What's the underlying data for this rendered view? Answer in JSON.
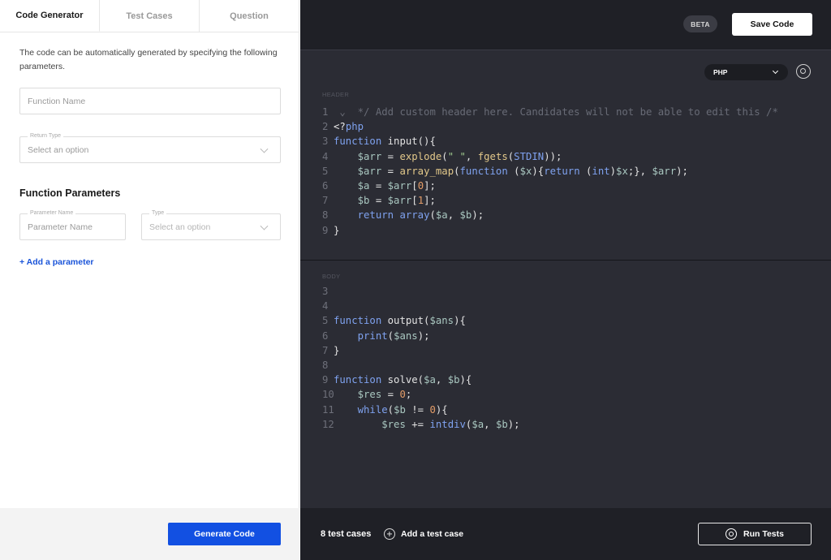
{
  "tabs": [
    {
      "label": "Code Generator",
      "active": true
    },
    {
      "label": "Test Cases",
      "active": false
    },
    {
      "label": "Question",
      "active": false
    }
  ],
  "left": {
    "description": "The code can be automatically generated by specifying the following parameters.",
    "function_name_placeholder": "Function Name",
    "return_type_label": "Return Type",
    "return_type_placeholder": "Select an option",
    "section_title": "Function Parameters",
    "param_name_label": "Parameter Name",
    "param_name_placeholder": "Parameter Name",
    "type_label": "Type",
    "type_placeholder": "Select an option",
    "add_parameter": "+ Add a parameter",
    "generate_button": "Generate Code"
  },
  "right": {
    "beta_badge": "BETA",
    "save_button": "Save Code",
    "language": "PHP",
    "header_label": "HEADER",
    "body_label": "BODY",
    "test_count": "8 test cases",
    "add_test_case": "Add a test case",
    "run_tests": "Run Tests"
  },
  "header_code": [
    {
      "n": "1",
      "fold": true,
      "tokens": [
        [
          "c-com",
          "*/ Add custom header here. Candidates will not be able to edit this /*"
        ]
      ]
    },
    {
      "n": "2",
      "tokens": [
        [
          "c-tag",
          "<?"
        ],
        [
          "c-kw",
          "php"
        ]
      ]
    },
    {
      "n": "3",
      "tokens": [
        [
          "c-kw",
          "function"
        ],
        [
          "",
          " input(){"
        ]
      ]
    },
    {
      "n": "4",
      "tokens": [
        [
          "",
          "    "
        ],
        [
          "c-var",
          "$arr"
        ],
        [
          "",
          " = "
        ],
        [
          "c-fn",
          "explode"
        ],
        [
          "",
          "("
        ],
        [
          "c-str",
          "\" \""
        ],
        [
          "",
          ", "
        ],
        [
          "c-fn",
          "fgets"
        ],
        [
          "",
          "("
        ],
        [
          "c-kw",
          "STDIN"
        ],
        [
          "",
          "));"
        ]
      ]
    },
    {
      "n": "5",
      "tokens": [
        [
          "",
          "    "
        ],
        [
          "c-var",
          "$arr"
        ],
        [
          "",
          " = "
        ],
        [
          "c-fn",
          "array_map"
        ],
        [
          "",
          "("
        ],
        [
          "c-kw",
          "function"
        ],
        [
          "",
          " ("
        ],
        [
          "c-var",
          "$x"
        ],
        [
          "",
          "){"
        ],
        [
          "c-kw",
          "return"
        ],
        [
          "",
          " ("
        ],
        [
          "c-kw",
          "int"
        ],
        [
          "",
          ")"
        ],
        [
          "c-var",
          "$x"
        ],
        [
          "",
          ";}, "
        ],
        [
          "c-var",
          "$arr"
        ],
        [
          "",
          ");"
        ]
      ]
    },
    {
      "n": "6",
      "tokens": [
        [
          "",
          "    "
        ],
        [
          "c-var",
          "$a"
        ],
        [
          "",
          " = "
        ],
        [
          "c-var",
          "$arr"
        ],
        [
          "",
          "["
        ],
        [
          "c-num",
          "0"
        ],
        [
          "",
          "];"
        ]
      ]
    },
    {
      "n": "7",
      "tokens": [
        [
          "",
          "    "
        ],
        [
          "c-var",
          "$b"
        ],
        [
          "",
          " = "
        ],
        [
          "c-var",
          "$arr"
        ],
        [
          "",
          "["
        ],
        [
          "c-num",
          "1"
        ],
        [
          "",
          "];"
        ]
      ]
    },
    {
      "n": "8",
      "tokens": [
        [
          "",
          "    "
        ],
        [
          "c-kw",
          "return"
        ],
        [
          "",
          " "
        ],
        [
          "c-kw",
          "array"
        ],
        [
          "",
          "("
        ],
        [
          "c-var",
          "$a"
        ],
        [
          "",
          ", "
        ],
        [
          "c-var",
          "$b"
        ],
        [
          "",
          ");"
        ]
      ]
    },
    {
      "n": "9",
      "tokens": [
        [
          "",
          "}"
        ]
      ]
    }
  ],
  "body_code": [
    {
      "n": "3",
      "tokens": []
    },
    {
      "n": "4",
      "tokens": []
    },
    {
      "n": "5",
      "tokens": [
        [
          "c-kw",
          "function"
        ],
        [
          "",
          " output("
        ],
        [
          "c-var",
          "$ans"
        ],
        [
          "",
          "){"
        ]
      ]
    },
    {
      "n": "6",
      "tokens": [
        [
          "",
          "    "
        ],
        [
          "c-kw",
          "print"
        ],
        [
          "",
          "("
        ],
        [
          "c-var",
          "$ans"
        ],
        [
          "",
          ");"
        ]
      ]
    },
    {
      "n": "7",
      "tokens": [
        [
          "",
          "}"
        ]
      ]
    },
    {
      "n": "8",
      "tokens": []
    },
    {
      "n": "9",
      "tokens": [
        [
          "c-kw",
          "function"
        ],
        [
          "",
          " solve("
        ],
        [
          "c-var",
          "$a"
        ],
        [
          "",
          ", "
        ],
        [
          "c-var",
          "$b"
        ],
        [
          "",
          "){"
        ]
      ]
    },
    {
      "n": "10",
      "tokens": [
        [
          "",
          "    "
        ],
        [
          "c-var",
          "$res"
        ],
        [
          "",
          " = "
        ],
        [
          "c-num",
          "0"
        ],
        [
          "",
          ";"
        ]
      ]
    },
    {
      "n": "11",
      "tokens": [
        [
          "",
          "    "
        ],
        [
          "c-kw",
          "while"
        ],
        [
          "",
          "("
        ],
        [
          "c-var",
          "$b"
        ],
        [
          "",
          " != "
        ],
        [
          "c-num",
          "0"
        ],
        [
          "",
          "){"
        ]
      ]
    },
    {
      "n": "12",
      "tokens": [
        [
          "",
          "        "
        ],
        [
          "c-var",
          "$res"
        ],
        [
          "",
          " += "
        ],
        [
          "c-kw",
          "intdiv"
        ],
        [
          "",
          "("
        ],
        [
          "c-var",
          "$a"
        ],
        [
          "",
          ", "
        ],
        [
          "c-var",
          "$b"
        ],
        [
          "",
          ");"
        ]
      ]
    }
  ]
}
